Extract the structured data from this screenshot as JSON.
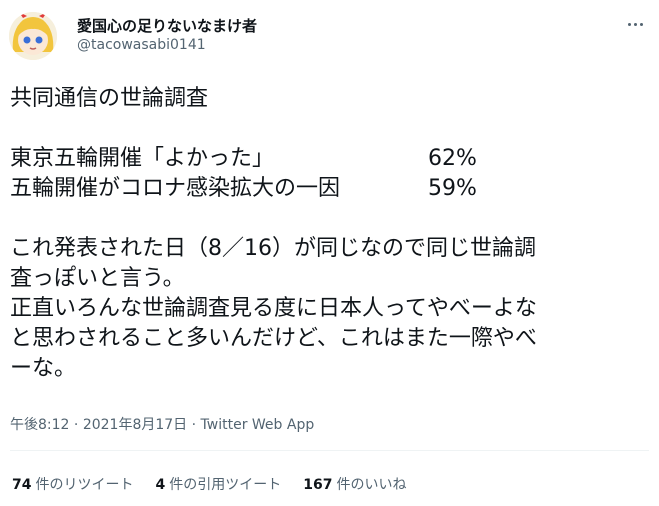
{
  "author": {
    "display_name": "愛国心の足りないなまけ者",
    "handle": "@tacowasabi0141"
  },
  "tweet": {
    "line1": "共同通信の世論調査",
    "poll": [
      {
        "label": "東京五輪開催「よかった」",
        "value": "62%"
      },
      {
        "label": "五輪開催がコロナ感染拡大の一因",
        "value": "59%"
      }
    ],
    "line2": "これ発表された日（8／16）が同じなので同じ世論調",
    "line3": "査っぽいと言う。",
    "line4": "正直いろんな世論調査見る度に日本人ってやべーよな",
    "line5": "と思わされること多いんだけど、これはまた一際やべ",
    "line6": "ーな。"
  },
  "meta": {
    "time": "午後8:12",
    "date": "2021年8月17日",
    "source": "Twitter Web App",
    "separator": " · "
  },
  "stats": {
    "retweets_count": "74",
    "retweets_label": "件のリツイート",
    "quotes_count": "4",
    "quotes_label": "件の引用ツイート",
    "likes_count": "167",
    "likes_label": "件のいいね"
  },
  "icons": {
    "more": "more-dots-icon",
    "avatar": "avatar-illustration"
  },
  "colors": {
    "text": "#0f1419",
    "secondary": "#536471",
    "divider": "#eff3f4"
  }
}
